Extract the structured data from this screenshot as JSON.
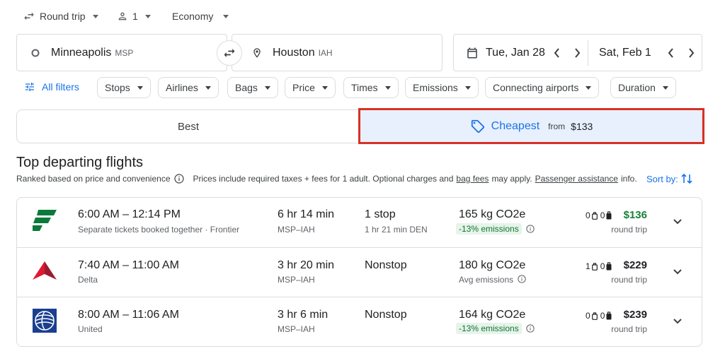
{
  "top": {
    "trip_type": "Round trip",
    "passengers": "1",
    "cabin": "Economy"
  },
  "search": {
    "origin_city": "Minneapolis",
    "origin_code": "MSP",
    "dest_city": "Houston",
    "dest_code": "IAH",
    "depart_date": "Tue, Jan 28",
    "return_date": "Sat, Feb 1"
  },
  "filters": {
    "all_filters": "All filters",
    "chips": [
      "Stops",
      "Airlines",
      "Bags",
      "Price",
      "Times",
      "Emissions",
      "Connecting airports",
      "Duration"
    ]
  },
  "tabs": {
    "best": "Best",
    "cheapest": "Cheapest",
    "cheapest_from": "from",
    "cheapest_price": "$133"
  },
  "results": {
    "title": "Top departing flights",
    "ranked": "Ranked based on price and convenience",
    "prices_text": "Prices include required taxes + fees for 1 adult. Optional charges and",
    "bag_fees": "bag fees",
    "may_apply": "may apply.",
    "passenger_assistance": "Passenger assistance",
    "info": "info.",
    "sort_by": "Sort by:"
  },
  "flights": [
    {
      "times": "6:00 AM – 12:14 PM",
      "airline": "Separate tickets booked together · Frontier",
      "duration": "6 hr 14 min",
      "route": "MSP–IAH",
      "stops": "1 stop",
      "layover": "1 hr 21 min DEN",
      "co2": "165 kg CO2e",
      "emissions": "-13% emissions",
      "carry_on": "0",
      "checked": "0",
      "price": "$136",
      "price_note": "round trip",
      "price_color": "#188038",
      "logo": "frontier"
    },
    {
      "times": "7:40 AM – 11:00 AM",
      "airline": "Delta",
      "duration": "3 hr 20 min",
      "route": "MSP–IAH",
      "stops": "Nonstop",
      "layover": "",
      "co2": "180 kg CO2e",
      "emissions": "Avg emissions",
      "carry_on": "1",
      "checked": "0",
      "price": "$229",
      "price_note": "round trip",
      "price_color": "#202124",
      "logo": "delta"
    },
    {
      "times": "8:00 AM – 11:06 AM",
      "airline": "United",
      "duration": "3 hr 6 min",
      "route": "MSP–IAH",
      "stops": "Nonstop",
      "layover": "",
      "co2": "164 kg CO2e",
      "emissions": "-13% emissions",
      "carry_on": "0",
      "checked": "0",
      "price": "$239",
      "price_note": "round trip",
      "price_color": "#202124",
      "logo": "united"
    }
  ],
  "colors": {
    "accent": "#1a73e8",
    "highlight": "#d93025",
    "tab_selected_bg": "#e8f0fe",
    "green": "#188038"
  }
}
